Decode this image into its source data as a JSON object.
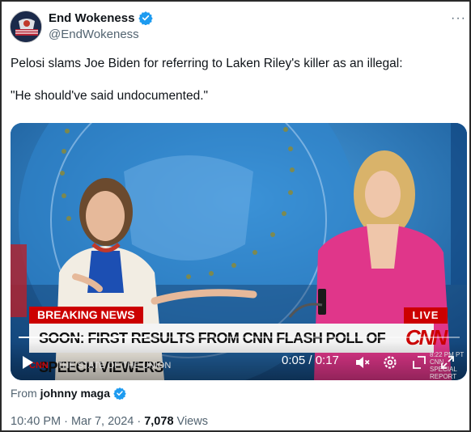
{
  "author": {
    "display_name": "End Wokeness",
    "handle": "@EndWokeness",
    "avatar_text": "END WOKENESS"
  },
  "tweet": {
    "line1": "Pelosi slams Joe Biden for referring to Laken Riley's killer as an illegal:",
    "line2": "\"He should've said undocumented.\""
  },
  "media": {
    "breaking_label": "BREAKING NEWS",
    "live_label": "LIVE",
    "ticker": "SOON: FIRST RESULTS FROM CNN FLASH POLL OF SPEECH VIEWERS",
    "network_logo": "CNN",
    "program_name": "THE STATE OF THE UNION",
    "network_mini": "CNN",
    "clock_time": "8:22 PM PT",
    "clock_sub": "CNN SPECIAL REPORT",
    "time_display": "0:05 / 0:17",
    "progress_fraction": 0.29
  },
  "from": {
    "prefix": "From",
    "name": "johnny maga"
  },
  "meta": {
    "timestamp": "10:40 PM · Mar 7, 2024 · ",
    "views_count": "7,078",
    "views_label": " Views"
  },
  "colors": {
    "verified": "#1d9bf0",
    "cnn_red": "#cc0000",
    "jacket_pink": "#e0368a",
    "studio_blue": "#1f6fb8"
  },
  "icons": [
    "verified-badge-icon",
    "more-options-icon",
    "play-icon",
    "mute-icon",
    "settings-icon",
    "fullscreen-icon",
    "expand-icon"
  ]
}
